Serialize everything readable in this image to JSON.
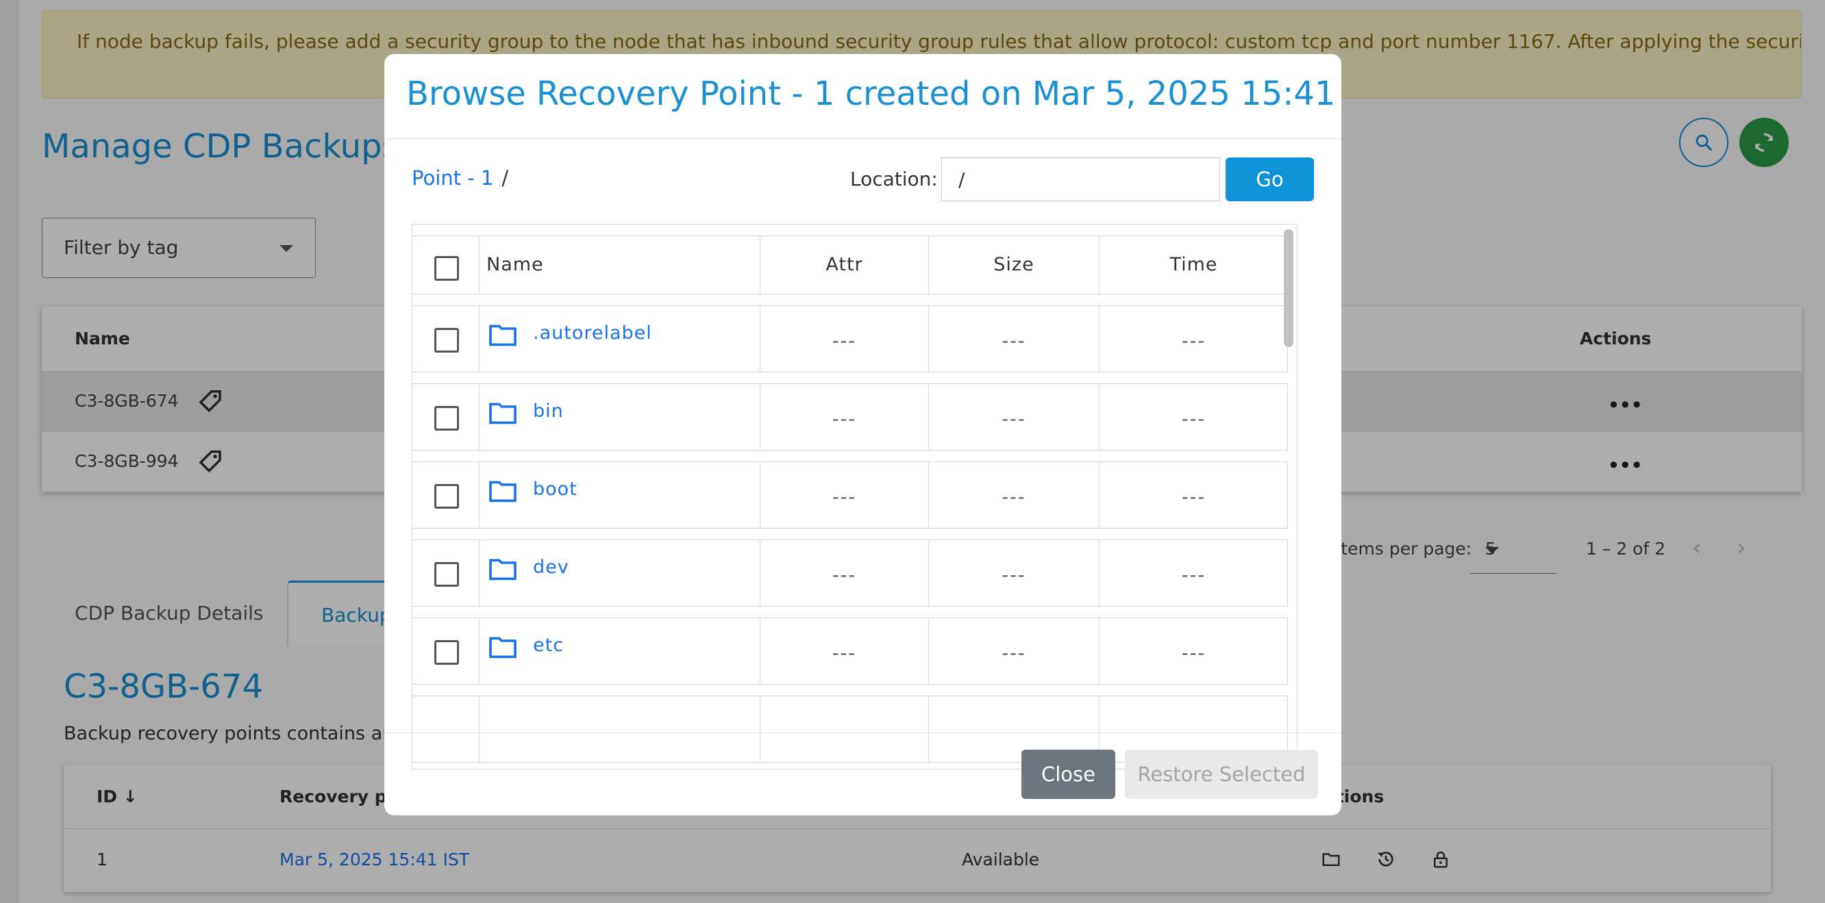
{
  "banner": {
    "text": "If node backup fails, please add a security group to the node that has inbound security group rules that allow protocol: custom tcp and port number 1167. After applying the security group to"
  },
  "page": {
    "title": "Manage CDP Backups (",
    "search_icon": "search-icon",
    "refresh_icon": "refresh-icon",
    "filter_placeholder": "Filter by tag"
  },
  "main_table": {
    "columns": {
      "name": "Name",
      "actions": "Actions"
    },
    "rows": [
      {
        "name": "C3-8GB-674",
        "actions": "•••"
      },
      {
        "name": "C3-8GB-994",
        "actions": "•••"
      }
    ]
  },
  "paginator": {
    "label": "Items per page:",
    "page_size": "5",
    "range": "1 – 2 of 2",
    "prev": "‹",
    "next": "›"
  },
  "tabs": [
    {
      "label": "CDP Backup Details"
    },
    {
      "label": "Backup"
    }
  ],
  "detail": {
    "title": "C3-8GB-674",
    "description": "Backup recovery points contains all"
  },
  "recovery_table": {
    "columns": {
      "id": "ID",
      "recovery_point": "Recovery poin",
      "actions": "ctions"
    },
    "rows": [
      {
        "id": "1",
        "recovery_point": "Mar 5, 2025 15:41 IST",
        "status": "Available"
      }
    ]
  },
  "modal": {
    "title": "Browse Recovery Point - 1 created on Mar 5, 2025 15:41 IST",
    "breadcrumb": {
      "link": "Point - 1",
      "separator": "/"
    },
    "location_label": "Location:",
    "location_value": "/",
    "go_label": "Go",
    "columns": {
      "name": "Name",
      "attr": "Attr",
      "size": "Size",
      "time": "Time"
    },
    "files": [
      {
        "name": ".autorelabel",
        "attr": "---",
        "size": "---",
        "time": "---"
      },
      {
        "name": "bin",
        "attr": "---",
        "size": "---",
        "time": "---"
      },
      {
        "name": "boot",
        "attr": "---",
        "size": "---",
        "time": "---"
      },
      {
        "name": "dev",
        "attr": "---",
        "size": "---",
        "time": "---"
      },
      {
        "name": "etc",
        "attr": "---",
        "size": "---",
        "time": "---"
      }
    ],
    "close_label": "Close",
    "restore_label": "Restore Selected"
  },
  "colors": {
    "primary": "#1a8fd1",
    "link": "#1a73e8",
    "go_button": "#0f93d8",
    "refresh_button": "#2b9a48",
    "close_button": "#6c757d",
    "banner_bg": "#fdf3c8",
    "banner_text": "#8a6a13"
  }
}
